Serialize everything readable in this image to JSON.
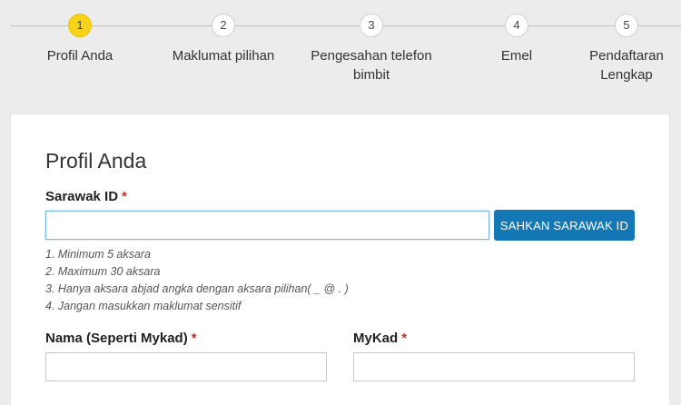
{
  "steps": [
    {
      "number": "1",
      "label": "Profil Anda",
      "active": true
    },
    {
      "number": "2",
      "label": "Maklumat pilihan",
      "active": false
    },
    {
      "number": "3",
      "label": "Pengesahan telefon bimbit",
      "active": false
    },
    {
      "number": "4",
      "label": "Emel",
      "active": false
    },
    {
      "number": "5",
      "label": "Pendaftaran Lengkap",
      "active": false
    }
  ],
  "form": {
    "title": "Profil Anda",
    "sarawak_id": {
      "label": "Sarawak ID",
      "required_mark": "*",
      "value": "",
      "placeholder": ""
    },
    "verify_button": "SAHKAN SARAWAK ID",
    "hints": [
      "1. Minimum 5 aksara",
      "2. Maximum 30 aksara",
      "3. Hanya aksara abjad angka dengan aksara pilihan( _ @ . )",
      "4. Jangan masukkan maklumat sensitif"
    ],
    "name_field": {
      "label": "Nama (Seperti Mykad)",
      "required_mark": "*",
      "value": ""
    },
    "mykad_field": {
      "label": "MyKad",
      "required_mark": "*",
      "value": ""
    }
  },
  "colors": {
    "active_step": "#f7d21a",
    "primary_button": "#1378b5",
    "required": "#e0241b",
    "background": "#ececec"
  }
}
